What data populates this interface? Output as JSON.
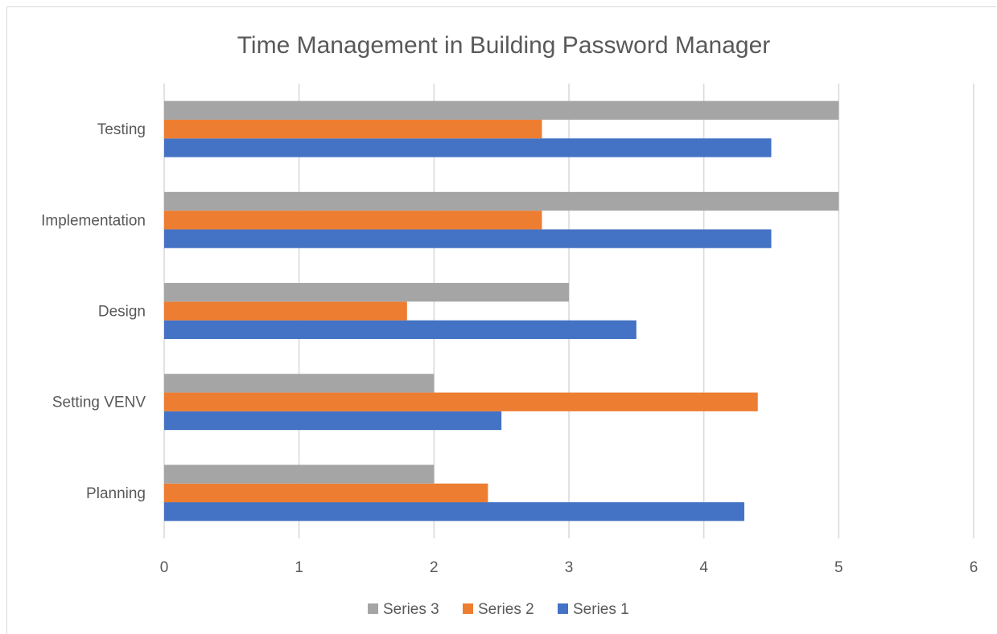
{
  "chart_data": {
    "type": "bar",
    "orientation": "horizontal",
    "title": "Time Management in Building Password Manager",
    "xlabel": "",
    "ylabel": "",
    "categories": [
      "Planning",
      "Setting VENV",
      "Design",
      "Implementation",
      "Testing"
    ],
    "series": [
      {
        "name": "Series 1",
        "color": "#4472c4",
        "values": [
          4.3,
          2.5,
          3.5,
          4.5,
          4.5
        ]
      },
      {
        "name": "Series 2",
        "color": "#ed7d31",
        "values": [
          2.4,
          4.4,
          1.8,
          2.8,
          2.8
        ]
      },
      {
        "name": "Series 3",
        "color": "#a5a5a5",
        "values": [
          2,
          2,
          3,
          5,
          5
        ]
      }
    ],
    "xlim": [
      0,
      6
    ],
    "x_ticks": [
      "0",
      "1",
      "2",
      "3",
      "4",
      "5",
      "6"
    ],
    "grid": "vertical",
    "legend": {
      "position": "bottom",
      "entries": [
        "Series 3",
        "Series 2",
        "Series 1"
      ]
    }
  }
}
